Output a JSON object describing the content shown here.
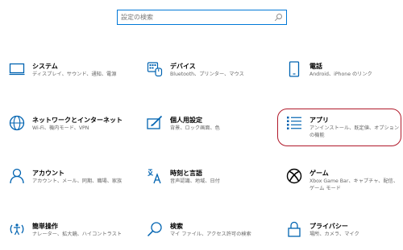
{
  "search": {
    "placeholder": "設定の検索"
  },
  "accent_color": "#0078d7",
  "highlight_color": "#b01829",
  "tiles": [
    {
      "title": "システム",
      "desc": "ディスプレイ、サウンド、通知、電源",
      "icon": "monitor-icon"
    },
    {
      "title": "デバイス",
      "desc": "Bluetooth、プリンター、マウス",
      "icon": "devices-icon"
    },
    {
      "title": "電話",
      "desc": "Android、iPhone のリンク",
      "icon": "phone-icon"
    },
    {
      "title": "ネットワークとインターネット",
      "desc": "Wi-Fi、機内モード、VPN",
      "icon": "globe-icon"
    },
    {
      "title": "個人用設定",
      "desc": "背景、ロック画面、色",
      "icon": "personalization-icon"
    },
    {
      "title": "アプリ",
      "desc": "アンインストール、既定値、オプションの機能",
      "icon": "apps-list-icon"
    },
    {
      "title": "アカウント",
      "desc": "アカウント、メール、同期、職場、家族",
      "icon": "person-icon"
    },
    {
      "title": "時刻と言語",
      "desc": "音声認識、地域、日付",
      "icon": "time-language-icon"
    },
    {
      "title": "ゲーム",
      "desc": "Xbox Game Bar、キャプチャ、配信、ゲーム モード",
      "icon": "xbox-icon"
    },
    {
      "title": "簡単操作",
      "desc": "ナレーター、拡大鏡、ハイコントラスト",
      "icon": "ease-of-access-icon"
    },
    {
      "title": "検索",
      "desc": "マイ ファイル、アクセス許可の検索",
      "icon": "search-icon"
    },
    {
      "title": "プライバシー",
      "desc": "場所、カメラ、マイク",
      "icon": "lock-icon"
    }
  ]
}
